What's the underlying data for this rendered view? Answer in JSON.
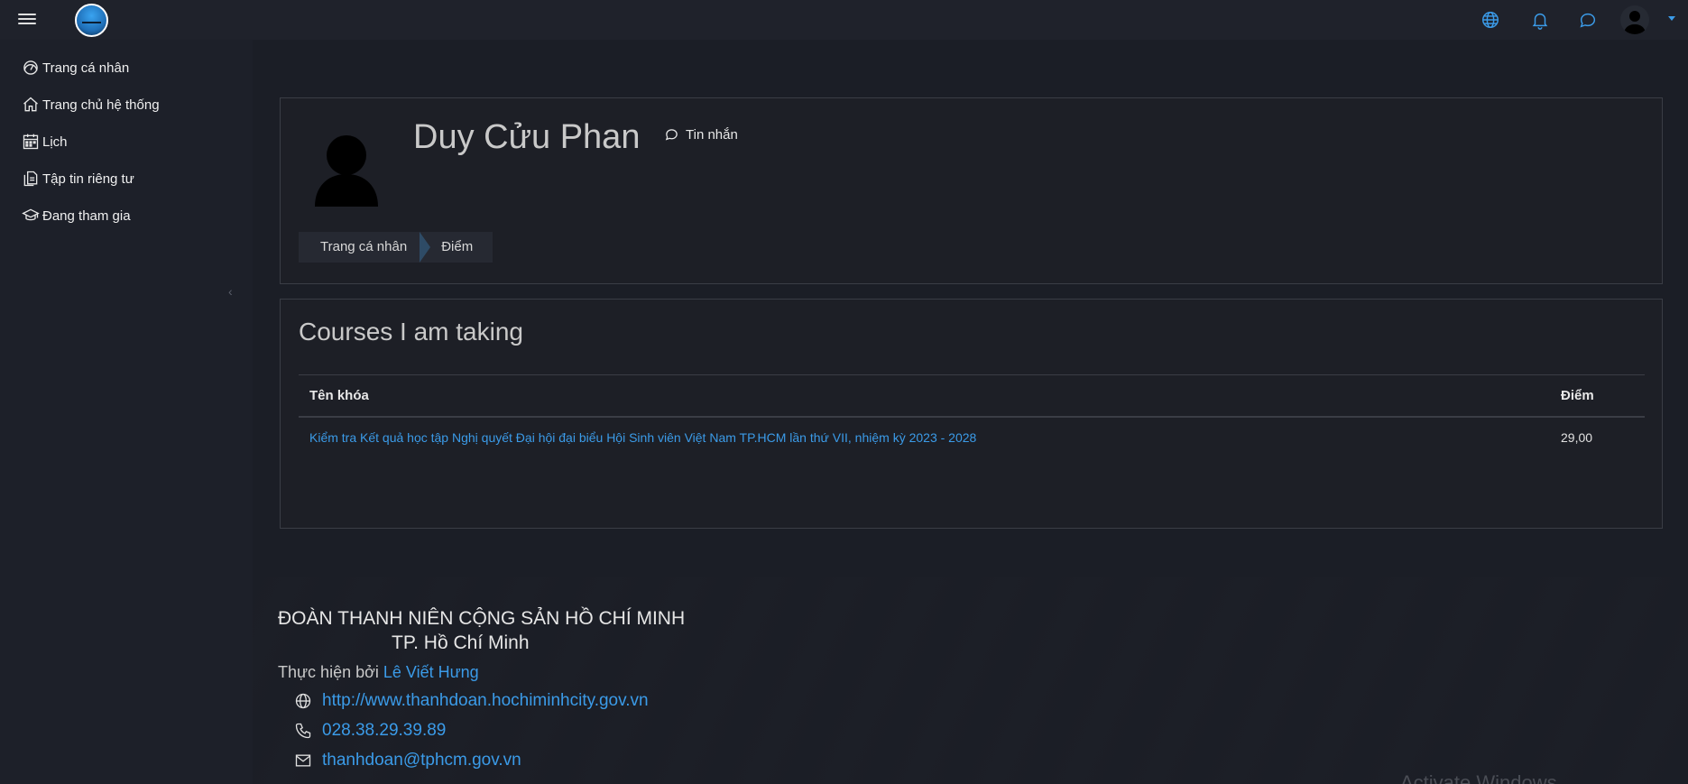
{
  "navbar": {
    "menu_icon": "hamburger-icon",
    "logo": "organization-logo",
    "icons": [
      "globe-icon",
      "bell-icon",
      "chat-icon"
    ],
    "accent": "#3b9be8"
  },
  "sidebar": {
    "items": [
      {
        "label": "Trang cá nhân",
        "icon": "dashboard-icon"
      },
      {
        "label": "Trang chủ hệ thống",
        "icon": "home-icon"
      },
      {
        "label": "Lịch",
        "icon": "calendar-icon"
      },
      {
        "label": "Tập tin riêng tư",
        "icon": "files-icon"
      },
      {
        "label": "Đang tham gia",
        "icon": "graduation-cap-icon"
      }
    ],
    "expand_glyph": "‹"
  },
  "profile": {
    "name": "Duy Cửu Phan",
    "message_label": "Tin nhắn",
    "breadcrumb": [
      "Trang cá nhân",
      "Điểm"
    ]
  },
  "courses": {
    "title": "Courses I am taking",
    "headers": {
      "course": "Tên khóa",
      "grade": "Điểm"
    },
    "rows": [
      {
        "course": "Kiểm tra Kết quả học tập Nghị quyết Đại hội đại biểu Hội Sinh viên Việt Nam TP.HCM lần thứ VII, nhiệm kỳ 2023 - 2028",
        "grade": "29,00"
      }
    ]
  },
  "footer": {
    "org_line1": "ĐOÀN THANH NIÊN CỘNG SẢN HỒ CHÍ MINH",
    "org_line2": "TP. Hồ Chí Minh",
    "credit_prefix": "Thực hiện bởi ",
    "credit_name": "Lê Viết Hưng",
    "website": "http://www.thanhdoan.hochiminhcity.gov.vn",
    "phone": "028.38.29.39.89",
    "email": "thanhdoan@tphcm.gov.vn"
  },
  "watermark": "Activate Windows"
}
